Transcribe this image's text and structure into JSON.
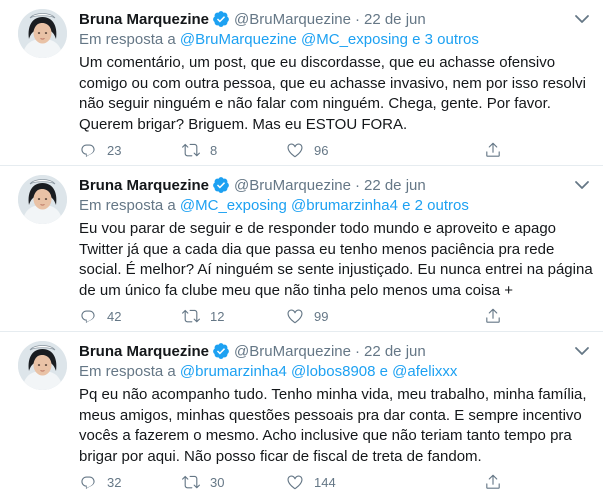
{
  "colors": {
    "accent": "#1da1f2",
    "muted": "#657786",
    "text": "#14171a",
    "divider": "#e6ecf0"
  },
  "icons": {
    "verified": "verified-badge-icon",
    "caret": "chevron-down-icon",
    "reply": "reply-icon",
    "retweet": "retweet-icon",
    "like": "heart-icon",
    "share": "share-icon"
  },
  "tweets": [
    {
      "name": "Bruna Marquezine",
      "handle": "@BruMarquezine",
      "dot": "·",
      "date": "22 de jun",
      "reply_prefix": "Em resposta a",
      "mentions": [
        "@BruMarquezine",
        "@MC_exposing"
      ],
      "conj": "e",
      "others": "3 outros",
      "text": "Um comentário, um post, que eu discordasse, que eu achasse ofensivo\ncomigo ou com outra pessoa, que eu achasse invasivo, nem por isso resolvi\nnão seguir ninguém e não falar com ninguém. Chega, gente. Por favor.\nQuerem brigar? Briguem. Mas eu ESTOU FORA.",
      "replies": "23",
      "retweets": "8",
      "likes": "96"
    },
    {
      "name": "Bruna Marquezine",
      "handle": "@BruMarquezine",
      "dot": "·",
      "date": "22 de jun",
      "reply_prefix": "Em resposta a",
      "mentions": [
        "@MC_exposing",
        "@brumarzinha4"
      ],
      "conj": "e",
      "others": "2 outros",
      "text": "Eu vou parar de seguir e de responder todo mundo e aproveito e apago\nTwitter já que a cada dia que passa eu tenho menos paciência pra rede\nsocial. É melhor? Aí ninguém se sente injustiçado. Eu nunca entrei na página\nde um único fa clube meu que não tinha pelo menos uma coisa +",
      "replies": "42",
      "retweets": "12",
      "likes": "99"
    },
    {
      "name": "Bruna Marquezine",
      "handle": "@BruMarquezine",
      "dot": "·",
      "date": "22 de jun",
      "reply_prefix": "Em resposta a",
      "mentions": [
        "@brumarzinha4",
        "@lobos8908"
      ],
      "conj": "e",
      "others": "@afelixxx",
      "text": "Pq eu não acompanho tudo. Tenho minha vida, meu trabalho, minha família,\nmeus amigos, minhas questões pessoais pra dar conta. E sempre incentivo\nvocês a fazerem o mesmo. Acho inclusive que não teriam tanto tempo pra\nbrigar por aqui. Não posso ficar de fiscal de treta de fandom.",
      "replies": "32",
      "retweets": "30",
      "likes": "144"
    }
  ]
}
